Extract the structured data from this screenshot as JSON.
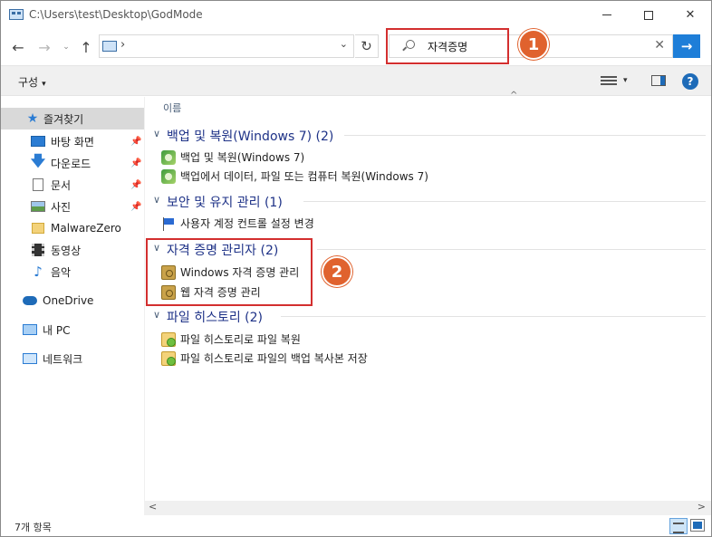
{
  "window": {
    "title": "C:\\Users\\test\\Desktop\\GodMode",
    "minimize_icon": "minimize-icon",
    "maximize_icon": "maximize-icon",
    "close_label": "✕"
  },
  "nav": {
    "back": "←",
    "forward": "→",
    "recent": "⌄",
    "up": "↑",
    "address_chevron": "›",
    "address_dropdown": "⌄",
    "refresh": "↻"
  },
  "search": {
    "value": "자격증명",
    "clear": "✕",
    "go": "→"
  },
  "toolbar": {
    "organize": "구성",
    "organize_caret": "▾",
    "view_caret": "▾",
    "help": "?"
  },
  "sidebar": {
    "quick_access": "즐겨찾기",
    "items": [
      {
        "label": "바탕 화면",
        "pinned": true
      },
      {
        "label": "다운로드",
        "pinned": true
      },
      {
        "label": "문서",
        "pinned": true
      },
      {
        "label": "사진",
        "pinned": true
      },
      {
        "label": "MalwareZero",
        "pinned": false
      },
      {
        "label": "동영상",
        "pinned": false
      },
      {
        "label": "음악",
        "pinned": false
      }
    ],
    "onedrive": "OneDrive",
    "this_pc": "내 PC",
    "network": "네트워크",
    "pin_glyph": "📌"
  },
  "content": {
    "column_name": "이름",
    "sort_arrow": "^",
    "groups": [
      {
        "title": "백업 및 복원(Windows 7) (2)",
        "items": [
          "백업 및 복원(Windows 7)",
          "백업에서 데이터, 파일 또는 컴퓨터 복원(Windows 7)"
        ]
      },
      {
        "title": "보안 및 유지 관리 (1)",
        "items": [
          "사용자 계정 컨트롤 설정 변경"
        ]
      },
      {
        "title": "자격 증명 관리자 (2)",
        "items": [
          "Windows 자격 증명 관리",
          "웹 자격 증명 관리"
        ]
      },
      {
        "title": "파일 히스토리 (2)",
        "items": [
          "파일 히스토리로 파일 복원",
          "파일 히스토리로 파일의 백업 복사본 저장"
        ]
      }
    ],
    "group_chevron": "∨"
  },
  "annotations": {
    "badge_1": "1",
    "badge_2": "2",
    "color": "#d32f2f",
    "badge_color": "#e0622e"
  },
  "scrollbar": {
    "left": "<",
    "right": ">"
  },
  "status": {
    "item_count": "7개 항목"
  }
}
